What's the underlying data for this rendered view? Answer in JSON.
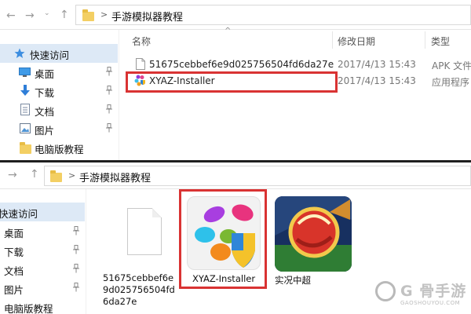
{
  "top_window": {
    "nav": {
      "back": "←",
      "forward": "→",
      "up": "↑",
      "chevron": "⌄"
    },
    "breadcrumb": {
      "separator": ">",
      "folder": "手游模拟器教程"
    },
    "sidebar": [
      {
        "label": "快速访问",
        "icon": "star-icon",
        "selected": true
      },
      {
        "label": "桌面",
        "icon": "desktop-icon",
        "pinned": true
      },
      {
        "label": "下载",
        "icon": "download-arrow-icon",
        "pinned": true
      },
      {
        "label": "文档",
        "icon": "document-icon",
        "pinned": true
      },
      {
        "label": "图片",
        "icon": "picture-icon",
        "pinned": true
      },
      {
        "label": "电脑版教程",
        "icon": "folder-icon",
        "pinned": false
      }
    ],
    "columns": {
      "name": "名称",
      "modified": "修改日期",
      "type": "类型"
    },
    "files": [
      {
        "name": "51675cebbef6e9d025756504fd6da27e",
        "modified": "2017/4/13 15:43",
        "type": "APK 文件",
        "icon": "generic-file-icon"
      },
      {
        "name": "XYAZ-Installer",
        "modified": "2017/4/13 15:43",
        "type": "应用程序",
        "icon": "xyaz-app-icon",
        "highlighted": true
      }
    ]
  },
  "bottom_window": {
    "breadcrumb": {
      "separator": ">",
      "folder": "手游模拟器教程"
    },
    "sidebar": [
      {
        "label": "快速访问",
        "selected": true
      },
      {
        "label": "桌面",
        "pinned": true
      },
      {
        "label": "下载",
        "pinned": true
      },
      {
        "label": "文档",
        "pinned": true
      },
      {
        "label": "图片",
        "pinned": true
      },
      {
        "label": "电脑版教程",
        "pinned": false
      }
    ],
    "tiles": [
      {
        "label_lines": [
          "51675cebbef6e",
          "9d025756504fd",
          "6da27e"
        ],
        "icon": "generic-file-icon"
      },
      {
        "label_lines": [
          "XYAZ-Installer"
        ],
        "icon": "xyaz-app-icon",
        "highlighted": true
      },
      {
        "label_lines": [
          "实况中超"
        ],
        "icon": "soccer-game-icon"
      }
    ]
  },
  "watermark": {
    "name": "G 骨手游",
    "url": "GAOSHOUYOU.COM"
  },
  "colors": {
    "highlight": "#d93333",
    "selected_bg": "#dde9f6",
    "folder": "#f3cf63"
  }
}
